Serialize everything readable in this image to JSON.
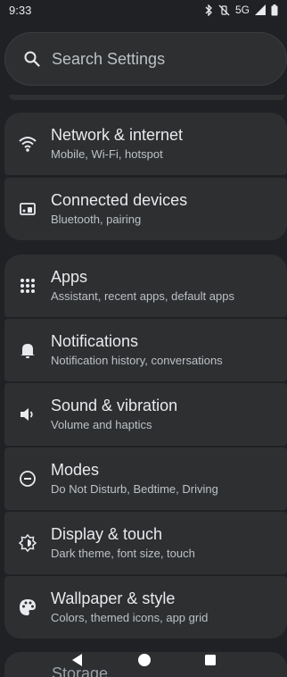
{
  "status": {
    "time": "9:33",
    "network": "5G"
  },
  "search": {
    "placeholder": "Search Settings"
  },
  "items": [
    {
      "title": "Network & internet",
      "subtitle": "Mobile, Wi-Fi, hotspot",
      "icon": "wifi-icon"
    },
    {
      "title": "Connected devices",
      "subtitle": "Bluetooth, pairing",
      "icon": "devices-icon"
    },
    {
      "title": "Apps",
      "subtitle": "Assistant, recent apps, default apps",
      "icon": "apps-grid-icon"
    },
    {
      "title": "Notifications",
      "subtitle": "Notification history, conversations",
      "icon": "bell-icon"
    },
    {
      "title": "Sound & vibration",
      "subtitle": "Volume and haptics",
      "icon": "speaker-icon"
    },
    {
      "title": "Modes",
      "subtitle": "Do Not Disturb, Bedtime, Driving",
      "icon": "modes-icon"
    },
    {
      "title": "Display & touch",
      "subtitle": "Dark theme, font size, touch",
      "icon": "brightness-icon"
    },
    {
      "title": "Wallpaper & style",
      "subtitle": "Colors, themed icons, app grid",
      "icon": "palette-icon"
    }
  ],
  "peek": {
    "title": "Storage"
  },
  "nav": {
    "back": "back-icon",
    "home": "home-icon",
    "recents": "recents-icon"
  },
  "colors": {
    "background": "#202124",
    "card": "#2d2f31",
    "text_primary": "#e8eaed",
    "text_secondary": "#bdc1c6"
  }
}
